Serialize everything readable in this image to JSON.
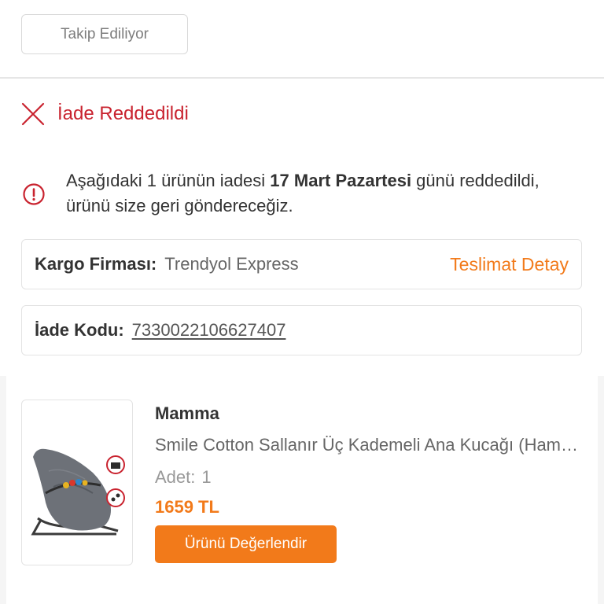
{
  "follow_button": {
    "label": "Takip Ediliyor"
  },
  "status": {
    "text": "İade Reddedildi",
    "color": "#c9232f",
    "icon": "close-x-icon"
  },
  "info": {
    "icon": "alert-circle-icon",
    "text_before": "Aşağıdaki 1 ürünün iadesi ",
    "date_bold": "17 Mart Pazartesi",
    "text_after": " günü reddedildi, ürünü size geri göndereceğiz."
  },
  "cargo": {
    "label": "Kargo Firması:",
    "value": "Trendyol Express",
    "detail_link": "Teslimat Detay"
  },
  "return_code": {
    "label": "İade Kodu:",
    "value": "7330022106627407"
  },
  "product": {
    "brand": "Mamma",
    "name": "Smile Cotton Sallanır Üç Kademeli Ana Kucağı (Hamak)",
    "qty_label": "Adet:",
    "qty_value": "1",
    "price": "1659 TL",
    "rate_button": "Ürünü Değerlendir",
    "image_badges": [
      "TAŞIMA ÇANTASI",
      "OYUNCAK APARATI"
    ]
  },
  "colors": {
    "accent": "#f27a1a",
    "error": "#c9232f"
  }
}
